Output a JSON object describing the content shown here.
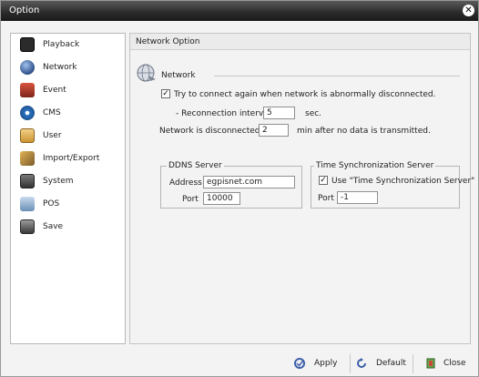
{
  "window": {
    "title": "Option"
  },
  "sidebar": {
    "items": [
      {
        "label": "Playback",
        "icon": "film-icon",
        "color": "#2b2b2b"
      },
      {
        "label": "Network",
        "icon": "globe-icon",
        "color": "#2d4f8a"
      },
      {
        "label": "Event",
        "icon": "event-icon",
        "color": "#b23b2a"
      },
      {
        "label": "CMS",
        "icon": "cms-gear-icon",
        "color": "#2c74c4"
      },
      {
        "label": "User",
        "icon": "user-icon",
        "color": "#c9952f"
      },
      {
        "label": "Import/Export",
        "icon": "import-export-icon",
        "color": "#7a5a2a"
      },
      {
        "label": "System",
        "icon": "system-icon",
        "color": "#4a4a4a"
      },
      {
        "label": "POS",
        "icon": "pos-icon",
        "color": "#6a8fb5"
      },
      {
        "label": "Save",
        "icon": "save-disk-icon",
        "color": "#5c5c5c"
      }
    ]
  },
  "panel": {
    "title": "Network Option",
    "network": {
      "heading": "Network",
      "reconnect_label": "Try to connect again when network is abnormally disconnected.",
      "reconnect_checked": true,
      "interval_label": "- Reconnection interval",
      "interval_value": "5",
      "interval_unit": "sec.",
      "disconnect_label": "Network is disconnected in",
      "disconnect_value": "2",
      "disconnect_suffix": "min after no data is transmitted."
    },
    "ddns": {
      "legend": "DDNS Server",
      "address_label": "Address",
      "address_value": "egpisnet.com",
      "port_label": "Port",
      "port_value": "10000"
    },
    "timesync": {
      "legend": "Time Synchronization Server",
      "use_label": "Use \"Time Synchronization Server\"",
      "use_checked": true,
      "port_label": "Port",
      "port_value": "-1"
    }
  },
  "footer": {
    "apply_label": "Apply",
    "default_label": "Default",
    "close_label": "Close"
  }
}
